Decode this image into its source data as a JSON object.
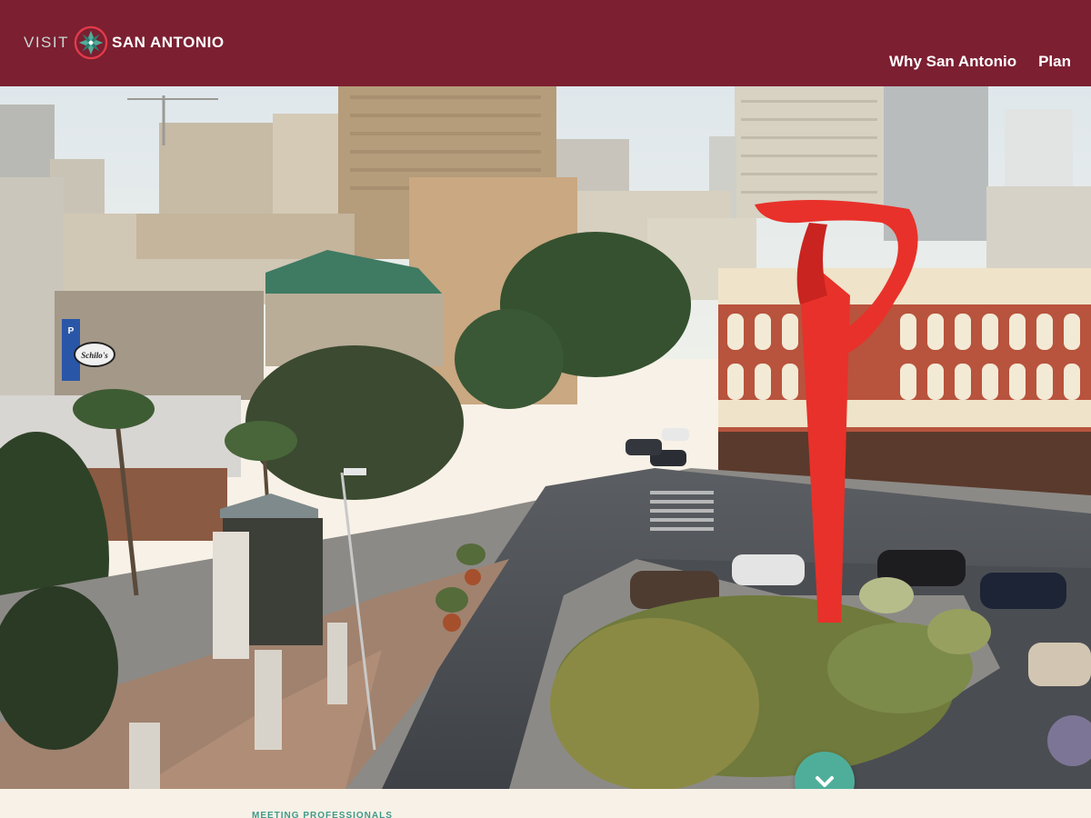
{
  "header": {
    "logo_visit": "VISIT",
    "logo_name": "SAN ANTONIO",
    "nav": [
      {
        "label": "Why San Antonio"
      },
      {
        "label": "Plan"
      }
    ]
  },
  "hero": {
    "sign_park": "PARK",
    "sign_schilo": "Schilo's"
  },
  "section": {
    "eyebrow": "MEETING PROFESSIONALS"
  },
  "colors": {
    "brand": "#7b1f31",
    "accent": "#4fae9a",
    "sculpture": "#e8312a",
    "strip": "#f8f1e7"
  },
  "icons": {
    "scroll": "chevron-down-icon",
    "logo": "star-flower-logo"
  }
}
